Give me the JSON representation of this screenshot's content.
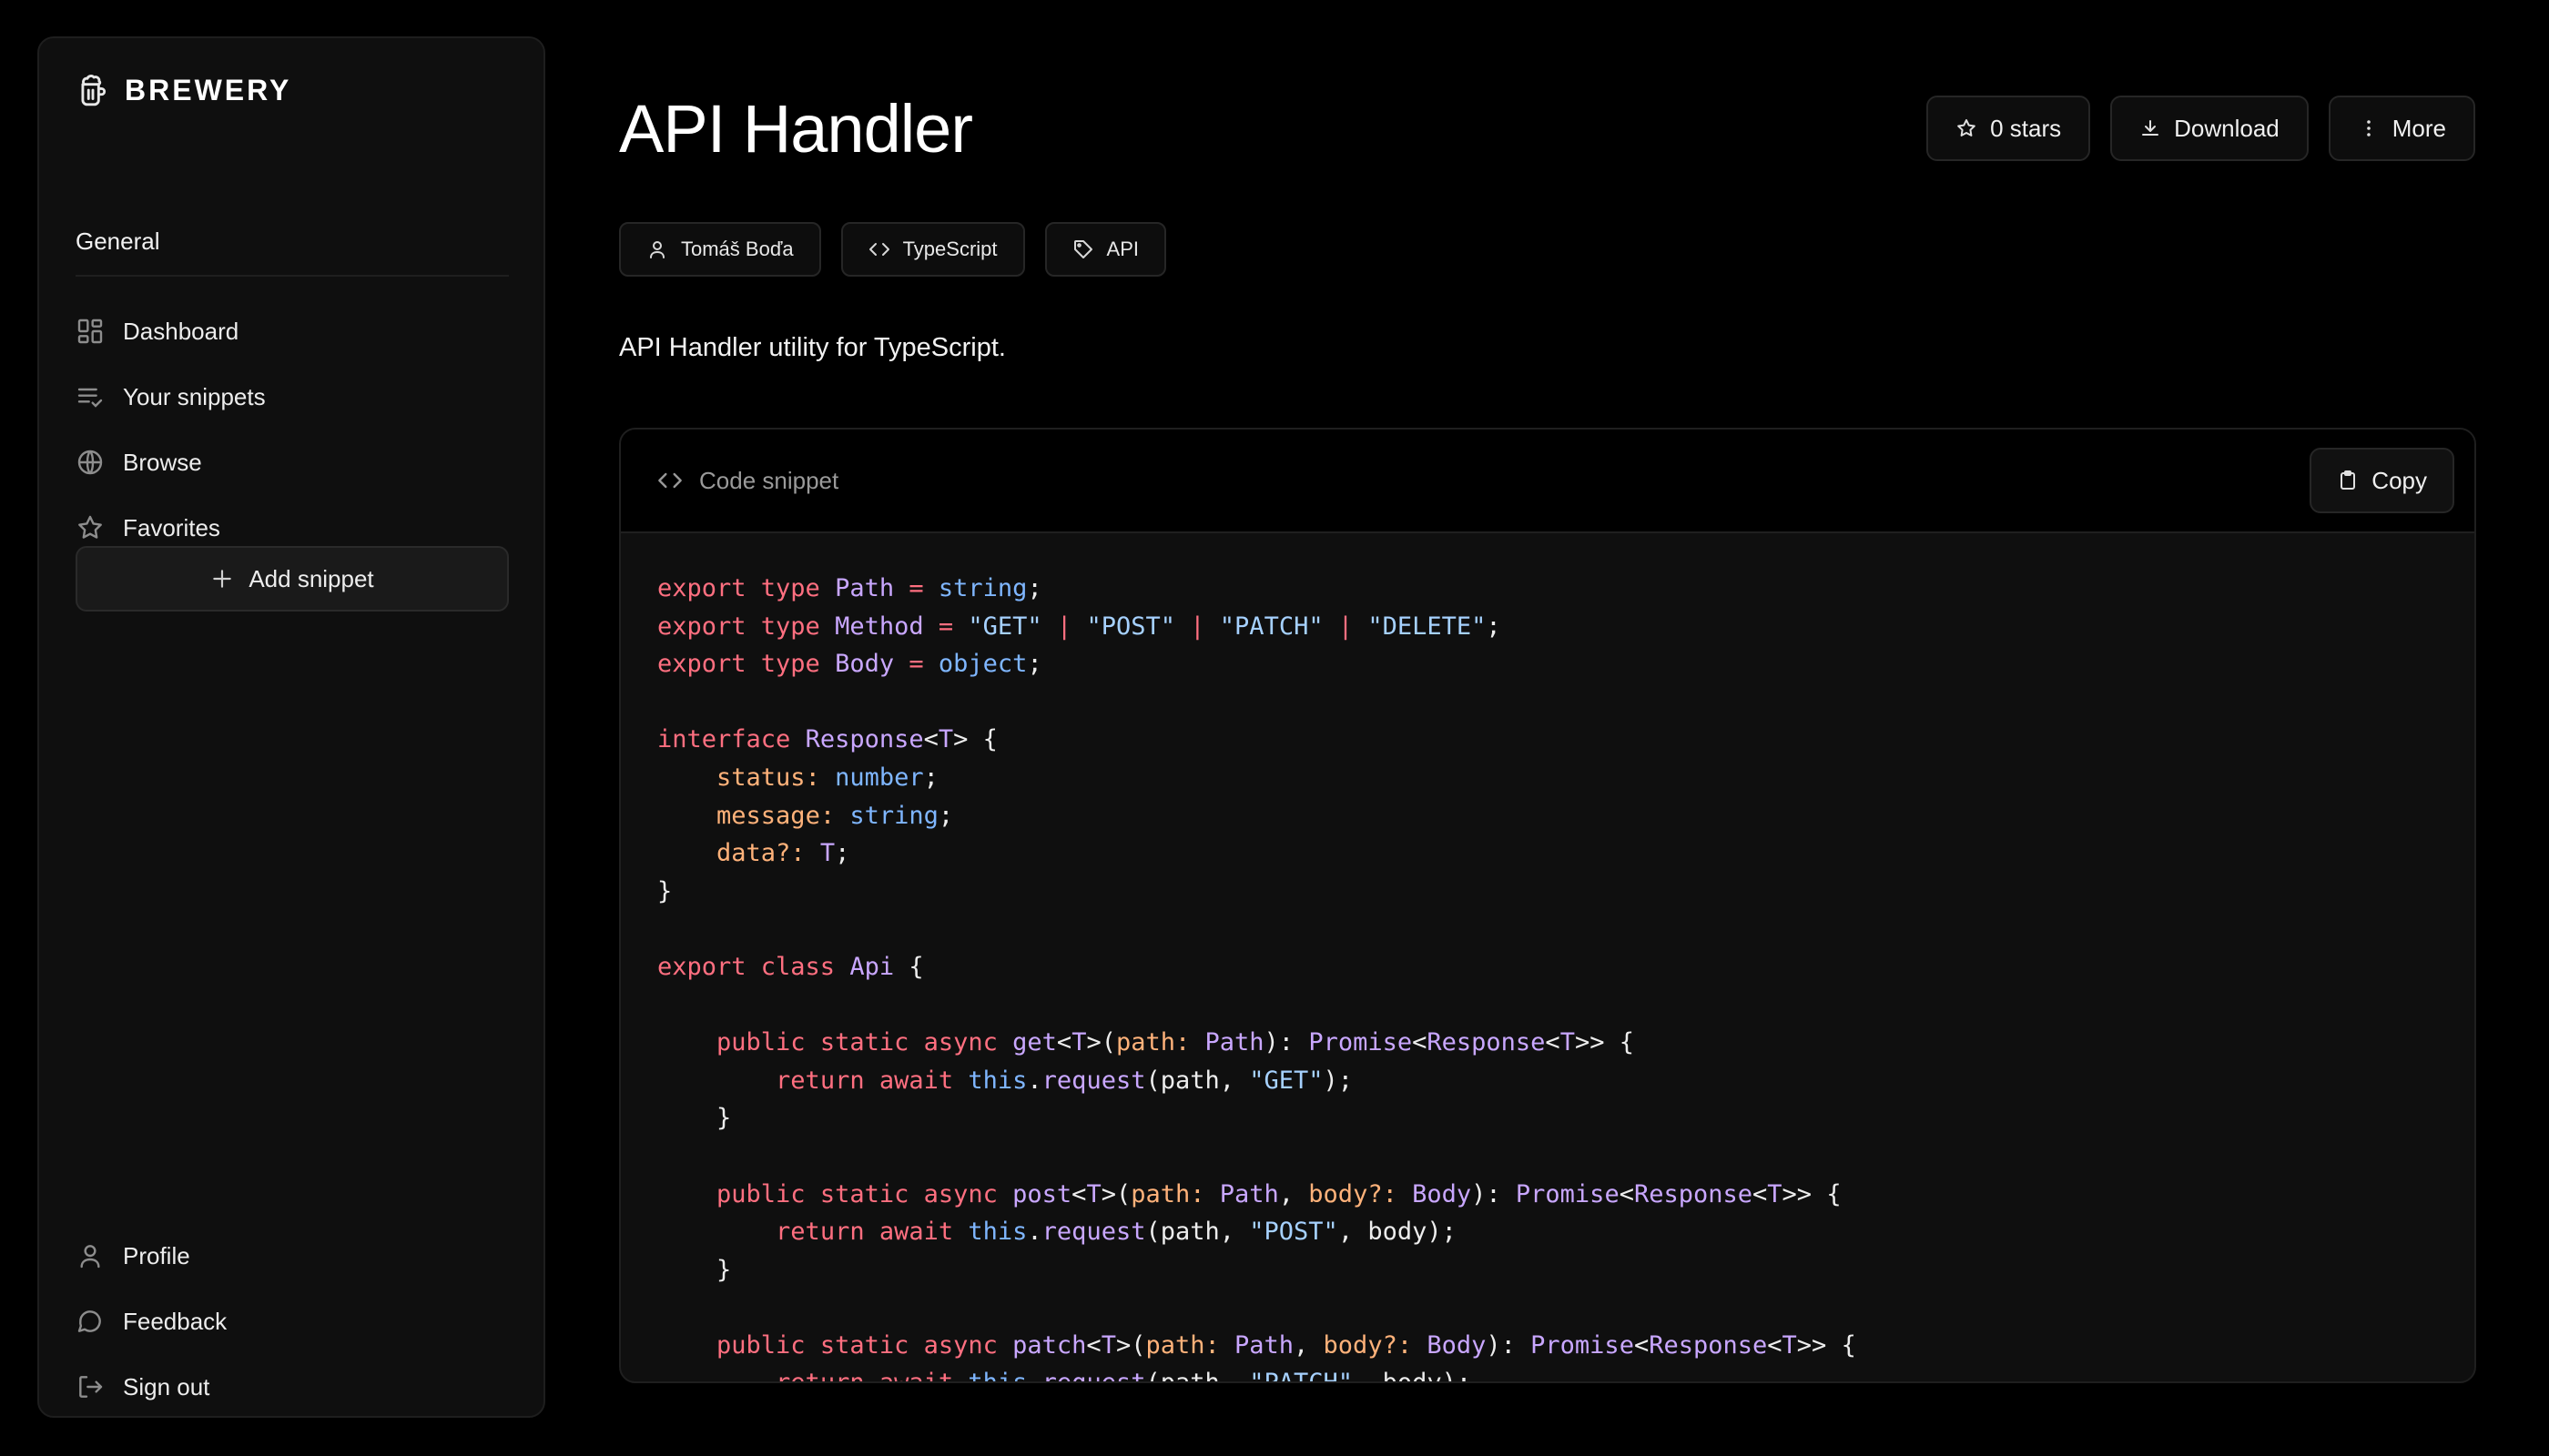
{
  "app": {
    "brand": "BREWERY"
  },
  "sidebar": {
    "section_title": "General",
    "nav": [
      {
        "label": "Dashboard",
        "icon": "dashboard-icon"
      },
      {
        "label": "Your snippets",
        "icon": "list-check-icon"
      },
      {
        "label": "Browse",
        "icon": "globe-icon"
      },
      {
        "label": "Favorites",
        "icon": "star-icon"
      }
    ],
    "add_label": "Add snippet",
    "bottom_nav": [
      {
        "label": "Profile",
        "icon": "user-icon"
      },
      {
        "label": "Feedback",
        "icon": "chat-icon"
      },
      {
        "label": "Sign out",
        "icon": "logout-icon"
      }
    ]
  },
  "snippet": {
    "title": "API Handler",
    "description": "API Handler utility for TypeScript.",
    "actions": {
      "stars": "0 stars",
      "download": "Download",
      "more": "More"
    },
    "tags": {
      "author": "Tomáš Boďa",
      "language": "TypeScript",
      "category": "API"
    },
    "code_header": "Code snippet",
    "copy_label": "Copy",
    "code_lines": [
      [
        [
          "k",
          "export type "
        ],
        [
          "t",
          "Path"
        ],
        [
          "k",
          " = "
        ],
        [
          "b",
          "string"
        ],
        [
          "",
          "; "
        ]
      ],
      [
        [
          "k",
          "export type "
        ],
        [
          "t",
          "Method"
        ],
        [
          "k",
          " = "
        ],
        [
          "s",
          "\"GET\""
        ],
        [
          "k",
          " | "
        ],
        [
          "s",
          "\"POST\""
        ],
        [
          "k",
          " | "
        ],
        [
          "s",
          "\"PATCH\""
        ],
        [
          "k",
          " | "
        ],
        [
          "s",
          "\"DELETE\""
        ],
        [
          "",
          ";"
        ]
      ],
      [
        [
          "k",
          "export type "
        ],
        [
          "t",
          "Body"
        ],
        [
          "k",
          " = "
        ],
        [
          "b",
          "object"
        ],
        [
          "",
          ";"
        ]
      ],
      [],
      [
        [
          "k",
          "interface "
        ],
        [
          "t",
          "Response"
        ],
        [
          "",
          "<"
        ],
        [
          "t",
          "T"
        ],
        [
          "",
          "> {"
        ]
      ],
      [
        [
          "",
          "    "
        ],
        [
          "p",
          "status:"
        ],
        [
          "",
          ""
        ],
        [
          "b",
          " number"
        ],
        [
          "",
          ";"
        ]
      ],
      [
        [
          "",
          "    "
        ],
        [
          "p",
          "message:"
        ],
        [
          "b",
          " string"
        ],
        [
          "",
          ";"
        ]
      ],
      [
        [
          "",
          "    "
        ],
        [
          "p",
          "data?:"
        ],
        [
          "t",
          " T"
        ],
        [
          "",
          ";"
        ]
      ],
      [
        [
          "",
          "}"
        ]
      ],
      [],
      [
        [
          "k",
          "export class "
        ],
        [
          "t",
          "Api"
        ],
        [
          "",
          " {"
        ]
      ],
      [],
      [
        [
          "",
          "    "
        ],
        [
          "k",
          "public static async "
        ],
        [
          "f",
          "get"
        ],
        [
          "",
          "<"
        ],
        [
          "t",
          "T"
        ],
        [
          "",
          ">("
        ],
        [
          "p",
          "path:"
        ],
        [
          "t",
          " Path"
        ],
        [
          "",
          "): "
        ],
        [
          "t",
          "Promise"
        ],
        [
          "",
          "<"
        ],
        [
          "t",
          "Response"
        ],
        [
          "",
          "<"
        ],
        [
          "t",
          "T"
        ],
        [
          "",
          ">> {"
        ]
      ],
      [
        [
          "",
          "        "
        ],
        [
          "k",
          "return await "
        ],
        [
          "b",
          "this"
        ],
        [
          "",
          "."
        ],
        [
          "f",
          "request"
        ],
        [
          "",
          "(path, "
        ],
        [
          "s",
          "\"GET\""
        ],
        [
          "",
          ");"
        ]
      ],
      [
        [
          "",
          "    }"
        ]
      ],
      [],
      [
        [
          "",
          "    "
        ],
        [
          "k",
          "public static async "
        ],
        [
          "f",
          "post"
        ],
        [
          "",
          "<"
        ],
        [
          "t",
          "T"
        ],
        [
          "",
          ">("
        ],
        [
          "p",
          "path:"
        ],
        [
          "t",
          " Path"
        ],
        [
          "",
          ", "
        ],
        [
          "p",
          "body?:"
        ],
        [
          "t",
          " Body"
        ],
        [
          "",
          "): "
        ],
        [
          "t",
          "Promise"
        ],
        [
          "",
          "<"
        ],
        [
          "t",
          "Response"
        ],
        [
          "",
          "<"
        ],
        [
          "t",
          "T"
        ],
        [
          "",
          ">> {"
        ]
      ],
      [
        [
          "",
          "        "
        ],
        [
          "k",
          "return await "
        ],
        [
          "b",
          "this"
        ],
        [
          "",
          "."
        ],
        [
          "f",
          "request"
        ],
        [
          "",
          "(path, "
        ],
        [
          "s",
          "\"POST\""
        ],
        [
          "",
          ", body);"
        ]
      ],
      [
        [
          "",
          "    }"
        ]
      ],
      [],
      [
        [
          "",
          "    "
        ],
        [
          "k",
          "public static async "
        ],
        [
          "f",
          "patch"
        ],
        [
          "",
          "<"
        ],
        [
          "t",
          "T"
        ],
        [
          "",
          ">("
        ],
        [
          "p",
          "path:"
        ],
        [
          "t",
          " Path"
        ],
        [
          "",
          ", "
        ],
        [
          "p",
          "body?:"
        ],
        [
          "t",
          " Body"
        ],
        [
          "",
          "): "
        ],
        [
          "t",
          "Promise"
        ],
        [
          "",
          "<"
        ],
        [
          "t",
          "Response"
        ],
        [
          "",
          "<"
        ],
        [
          "t",
          "T"
        ],
        [
          "",
          ">> {"
        ]
      ],
      [
        [
          "",
          "        "
        ],
        [
          "k",
          "return await "
        ],
        [
          "b",
          "this"
        ],
        [
          "",
          "."
        ],
        [
          "f",
          "request"
        ],
        [
          "",
          "(path, "
        ],
        [
          "s",
          "\"PATCH\""
        ],
        [
          "",
          ", body);"
        ]
      ]
    ]
  },
  "colors": {
    "background": "#000000",
    "surface": "#0f0f0f",
    "border": "#1f1f1f",
    "keyword": "#ff6f80",
    "type": "#c9a7ff",
    "string": "#a6d1ff",
    "param": "#ffb27a"
  }
}
